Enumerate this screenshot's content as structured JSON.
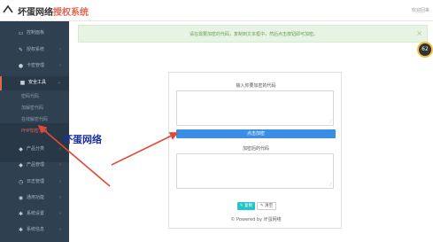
{
  "header": {
    "brand_main": "坏蛋网络",
    "brand_accent": "授权系统",
    "right_text": "欢迎回来"
  },
  "sidebar": {
    "items": [
      {
        "icon": "monitor-icon",
        "glyph": "▭",
        "label": "控制面板"
      },
      {
        "icon": "wrench-icon",
        "glyph": "✎",
        "label": "授权系统"
      },
      {
        "icon": "user-icon",
        "glyph": "●",
        "label": "卡密管理"
      },
      {
        "icon": "lock-icon",
        "glyph": "■",
        "label": "安全工具"
      },
      {
        "icon": "cart-icon",
        "glyph": "◆",
        "label": "产品分类"
      },
      {
        "icon": "box-icon",
        "glyph": "◆",
        "label": "产品管理"
      },
      {
        "icon": "clock-icon",
        "glyph": "◷",
        "label": "日志管理"
      },
      {
        "icon": "globe-icon",
        "glyph": "◉",
        "label": "通用功能"
      },
      {
        "icon": "gear-icon",
        "glyph": "✱",
        "label": "系统设置"
      },
      {
        "icon": "settings-icon",
        "glyph": "✱",
        "label": "系统信息"
      }
    ],
    "sub_items": [
      {
        "label": "密码代码"
      },
      {
        "label": "加解密代码"
      },
      {
        "label": "在线解密代码"
      },
      {
        "label": "PHP加密工具"
      }
    ]
  },
  "alert": {
    "text": "请在需要加密的代码，复制到文本框中，然后点击按钮即可加密。",
    "close": "×"
  },
  "badge": {
    "text": "62"
  },
  "card": {
    "input_label": "输入你要加密的代码",
    "encrypt_button": "点击加密",
    "output_label": "加密后的代码",
    "copy_button": "✎ 复制",
    "clear_button": "✎ 清空",
    "powered_by": "© Powered by 坏蛋网络"
  },
  "annotation": {
    "text": "坏蛋网络"
  },
  "colors": {
    "sidebar_bg": "#2f4050",
    "accent": "#e06650",
    "primary": "#3a8ee6",
    "arrow": "#e0483a"
  }
}
